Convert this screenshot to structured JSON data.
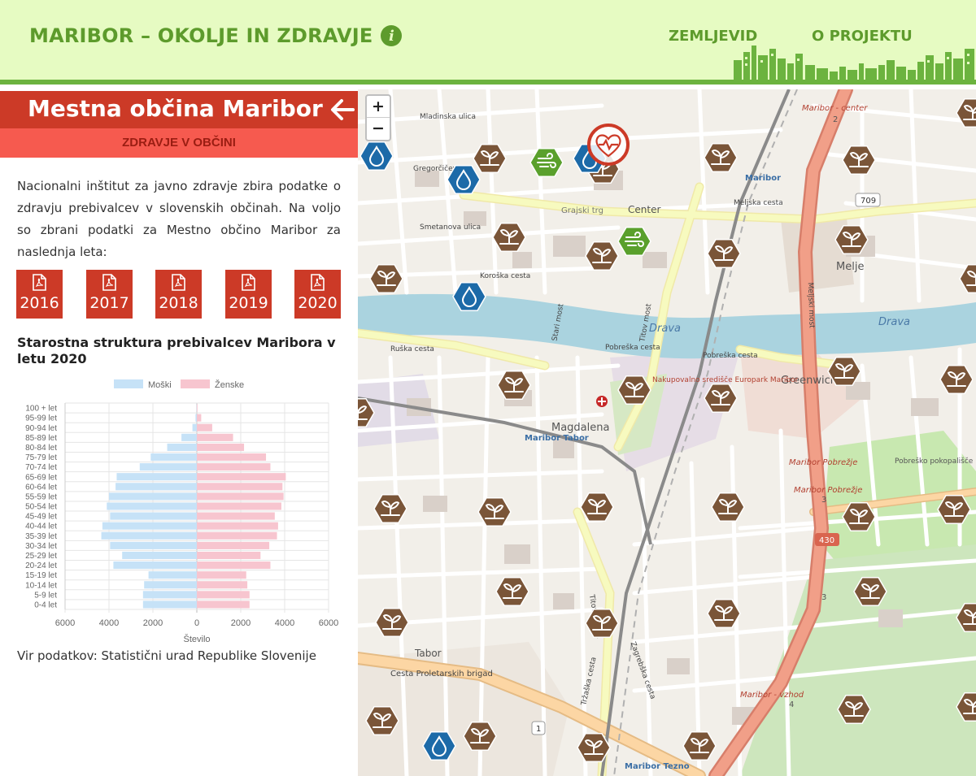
{
  "header": {
    "title": "MARIBOR – OKOLJE IN ZDRAVJE",
    "info_icon": "info-icon",
    "nav": {
      "map": "ZEMLJEVID",
      "about": "O PROJEKTU"
    }
  },
  "panel": {
    "title": "Mestna občina Maribor",
    "back_icon": "arrow-left-icon",
    "subtab": "ZDRAVJE V OBČINI",
    "intro": "Nacionalni inštitut za javno zdravje zbira podatke o zdravju prebivalcev v slovenskih občinah. Na voljo so zbrani podatki za Mestno občino Maribor za naslednja leta:",
    "years": [
      "2016",
      "2017",
      "2018",
      "2019",
      "2020"
    ],
    "chart_title": "Starostna struktura prebivalcev Maribora v letu 2020",
    "source": "Vir podatkov: Statistični urad Republike Slovenije"
  },
  "chart_data": {
    "type": "bar",
    "orientation": "horizontal",
    "categories": [
      "100 + let",
      "95-99 let",
      "90-94 let",
      "85-89 let",
      "80-84 let",
      "75-79 let",
      "70-74 let",
      "65-69 let",
      "60-64 let",
      "55-59 let",
      "50-54 let",
      "45-49 let",
      "40-44 let",
      "35-39 let",
      "30-34 let",
      "25-29 let",
      "20-24 let",
      "15-19 let",
      "10-14 let",
      "5-9 let",
      "0-4 let"
    ],
    "series": [
      {
        "name": "Moški",
        "color": "#c6e2f7",
        "values": [
          10,
          60,
          200,
          700,
          1350,
          2100,
          2600,
          3650,
          3700,
          4000,
          4100,
          3950,
          4300,
          4350,
          3950,
          3400,
          3800,
          2200,
          2400,
          2450,
          2450
        ]
      },
      {
        "name": "Ženske",
        "color": "#f7c5cf",
        "values": [
          30,
          200,
          700,
          1650,
          2150,
          3150,
          3350,
          4050,
          3900,
          3950,
          3850,
          3550,
          3700,
          3650,
          3300,
          2900,
          3350,
          2250,
          2300,
          2400,
          2400
        ]
      }
    ],
    "xlabel": "Število",
    "xticks": [
      "6000",
      "4000",
      "2000",
      "0",
      "2000",
      "4000",
      "6000"
    ],
    "xlim": [
      -6000,
      6000
    ],
    "legend": "top",
    "grid": true
  },
  "map": {
    "zoom_in": "+",
    "zoom_out": "−",
    "marker_colors": {
      "soil": "#7a5538",
      "water": "#1c6aa8",
      "air": "#5aa02c",
      "health": "#cc3a27"
    },
    "road_colors": {
      "motorway": "#e9967a",
      "primary": "#fcd6a4",
      "secondary": "#f7fabf",
      "river": "#aad3df",
      "park": "#c8e8b0"
    },
    "labels": {
      "river_1": "Drava",
      "river_2": "Drava",
      "center": "Center",
      "grajski": "Grajski trg",
      "magdalena": "Magdalena",
      "mb_tabor": "Maribor Tabor",
      "tabor": "Tabor",
      "greenwich": "Greenwich",
      "melje": "Melje",
      "pobrezje_1": "Maribor Pobrežje",
      "pobrezje_2": "Maribor Pobrežje",
      "mb_center": "Maribor - center",
      "mb_vzhod": "Maribor - vzhod",
      "mb_tezno": "Maribor Tezno",
      "maribor_st": "Maribor",
      "europark": "Nakupovalno središče Europark Maribor",
      "pobresko": "Pobreško pokopališče",
      "mladinska": "Mladinska ulica",
      "gregorciceva": "Gregorčičeva",
      "melj_cesta": "Meljska cesta",
      "titov_most": "Titov most",
      "stari_most": "Stari most",
      "koroska": "Koroška cesta",
      "pobreska_1": "Pobreška cesta",
      "pobreska_2": "Pobreška cesta",
      "proleterskih": "Cesta Proletarskih brigad",
      "titova": "Titova cesta",
      "trzaska": "Tržaška cesta",
      "meljski_most": "Meljski most",
      "zagrebska": "Zagrebška cesta",
      "ruska": "Ruška cesta",
      "smetanova": "Smetanova ulica",
      "road_709": "709",
      "road_430": "430",
      "road_1": "1",
      "road_2": "2",
      "road_3a": "3",
      "road_3b": "3",
      "road_4": "4"
    }
  }
}
